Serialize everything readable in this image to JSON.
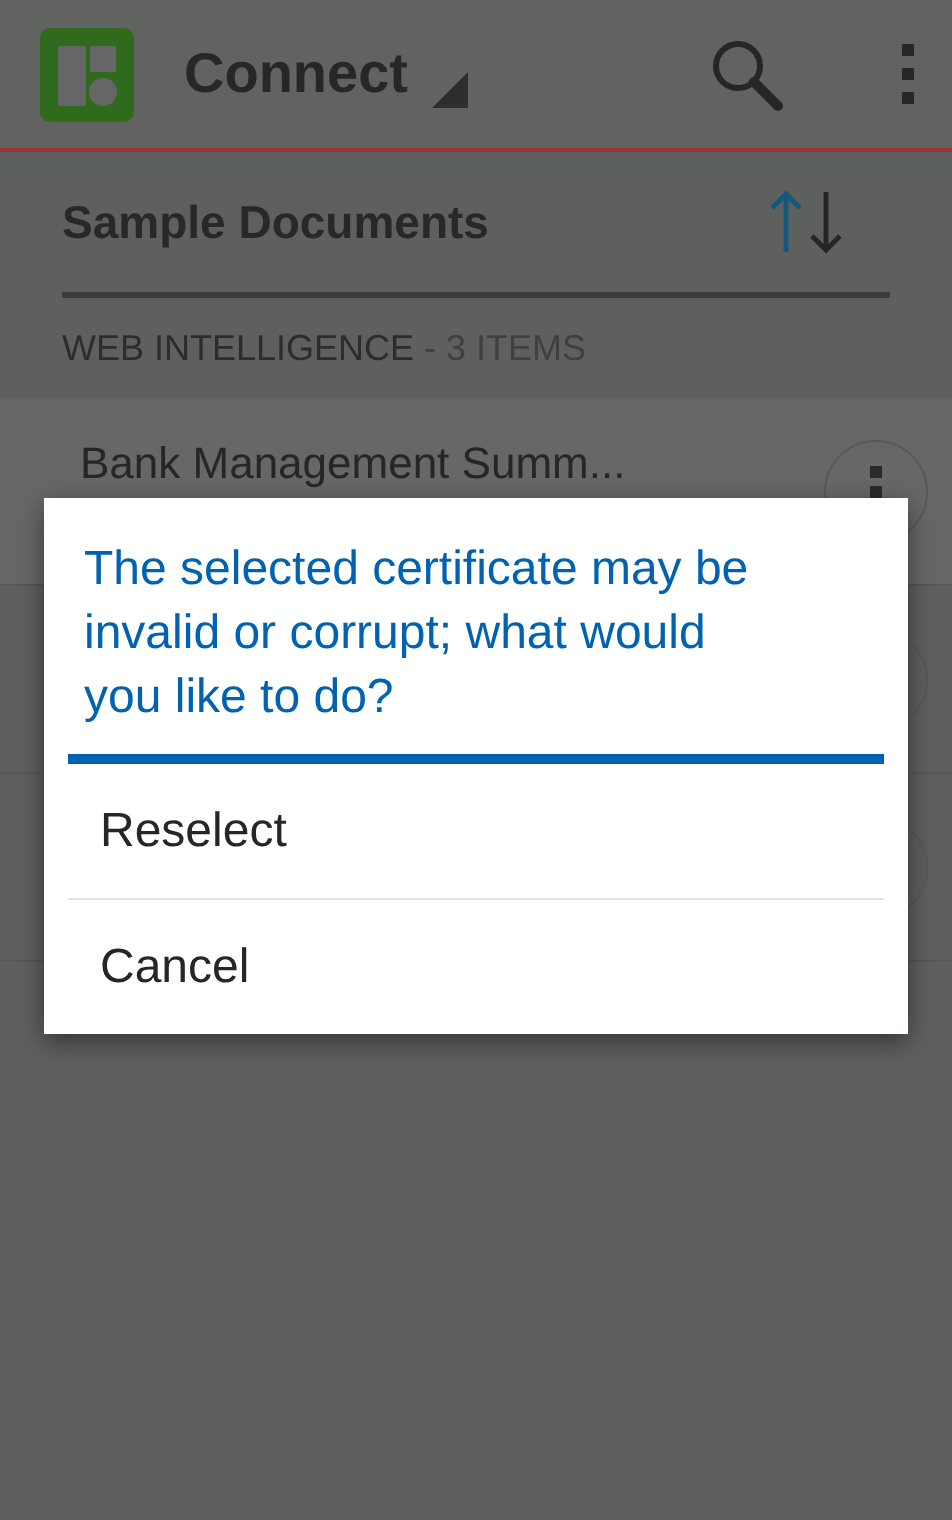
{
  "app_bar": {
    "title": "Connect"
  },
  "section": {
    "title": "Sample Documents",
    "group_label": "WEB INTELLIGENCE",
    "count_label": "- 3 ITEMS"
  },
  "documents": [
    {
      "title": "Bank Management Summ..."
    }
  ],
  "dialog": {
    "message": "The selected certificate may be invalid or corrupt; what would you like to do?",
    "options": [
      {
        "label": "Reselect"
      },
      {
        "label": "Cancel"
      }
    ]
  }
}
